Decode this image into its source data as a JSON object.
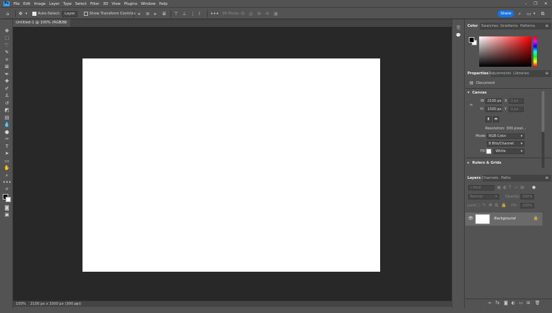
{
  "menu": {
    "logo": "Ps",
    "items": [
      "File",
      "Edit",
      "Image",
      "Layer",
      "Type",
      "Select",
      "Filter",
      "3D",
      "View",
      "Plugins",
      "Window",
      "Help"
    ]
  },
  "options": {
    "auto_select_label": "Auto-Select:",
    "auto_select_target": "Layer",
    "show_transform_label": "Show Transform Controls",
    "mode_3d": "3D Mode:",
    "share_label": "Share"
  },
  "document": {
    "tab_title": "Untitled-1 @ 100% (RGB/8)",
    "zoom": "100%",
    "doc_info": "2100 px x 1500 px (300 ppi)"
  },
  "color_panel": {
    "tabs": [
      "Color",
      "Swatches",
      "Gradients",
      "Patterns"
    ]
  },
  "properties_panel": {
    "tabs": [
      "Properties",
      "Adjustments",
      "Libraries"
    ],
    "kind": "Document",
    "canvas_section": "Canvas",
    "width_label": "W",
    "width_value": "2100 px",
    "height_label": "H",
    "height_value": "1500 px",
    "x_label": "X",
    "x_value": "0 px",
    "y_label": "Y",
    "y_value": "0 px",
    "resolution": "Resolution: 300 pixel...",
    "mode_label": "Mode",
    "mode_value": "RGB Color",
    "depth_value": "8 Bits/Channel",
    "fill_label": "Fill",
    "fill_value": "White",
    "rulers_section": "Rulers & Grids"
  },
  "layers_panel": {
    "tabs": [
      "Layers",
      "Channels",
      "Paths"
    ],
    "filter_placeholder": "Kind",
    "blend_mode": "Normal",
    "opacity_label": "Opacity:",
    "opacity_value": "100%",
    "lock_label": "Lock:",
    "fill_label": "Fill:",
    "fill_value": "100%",
    "layers": [
      {
        "name": "Background"
      }
    ]
  },
  "colors": {
    "accent": "#1473e6",
    "canvas": "#ffffff",
    "workspace": "#282828",
    "ui": "#535353"
  }
}
